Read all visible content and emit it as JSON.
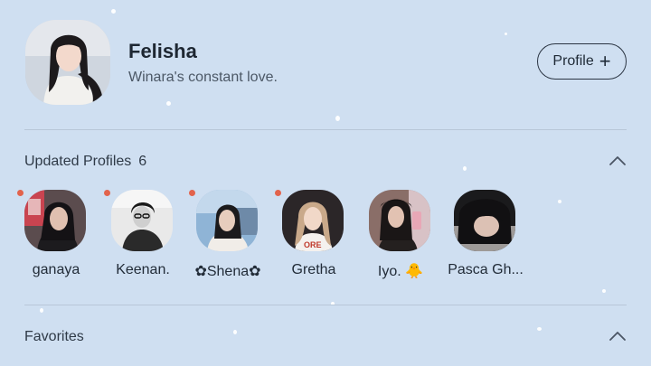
{
  "my_profile": {
    "name": "Felisha",
    "status": "Winara's constant love.",
    "profile_button_label": "Profile",
    "profile_button_icon": "+"
  },
  "updated_profiles": {
    "title": "Updated Profiles",
    "count": "6",
    "items": [
      {
        "name": "ganaya",
        "new": true
      },
      {
        "name": "Keenan.",
        "new": true
      },
      {
        "name": "✿Shena✿",
        "new": true
      },
      {
        "name": "Gretha",
        "new": true
      },
      {
        "name": "Iyo. 🐥",
        "new": false
      },
      {
        "name": "Pasca Gh...",
        "new": false
      }
    ]
  },
  "favorites": {
    "title": "Favorites"
  },
  "colors": {
    "background": "#cfdff1",
    "new_dot": "#e2634c",
    "divider": "#b8c7d8"
  }
}
